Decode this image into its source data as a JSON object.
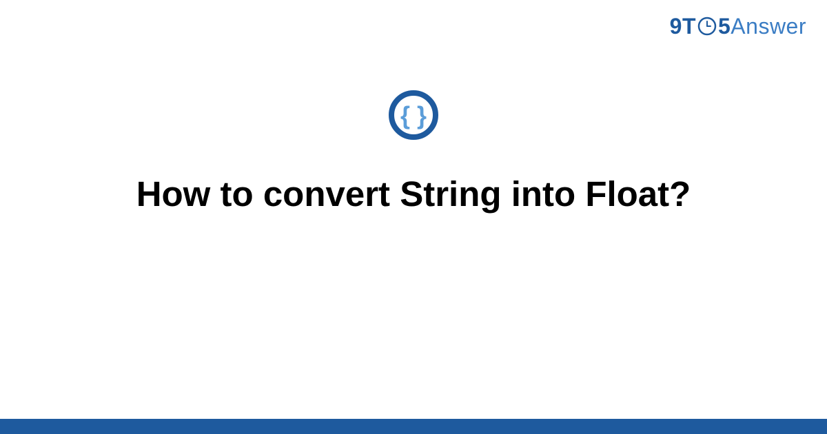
{
  "logo": {
    "prefix": "9T",
    "suffix": "5",
    "answer": "Answer"
  },
  "title": "How to convert String into Float?",
  "colors": {
    "brand_dark": "#1e5a9e",
    "brand_light": "#3b7dc4",
    "icon_outer": "#1e5a9e",
    "icon_inner": "#5b9dd9"
  }
}
